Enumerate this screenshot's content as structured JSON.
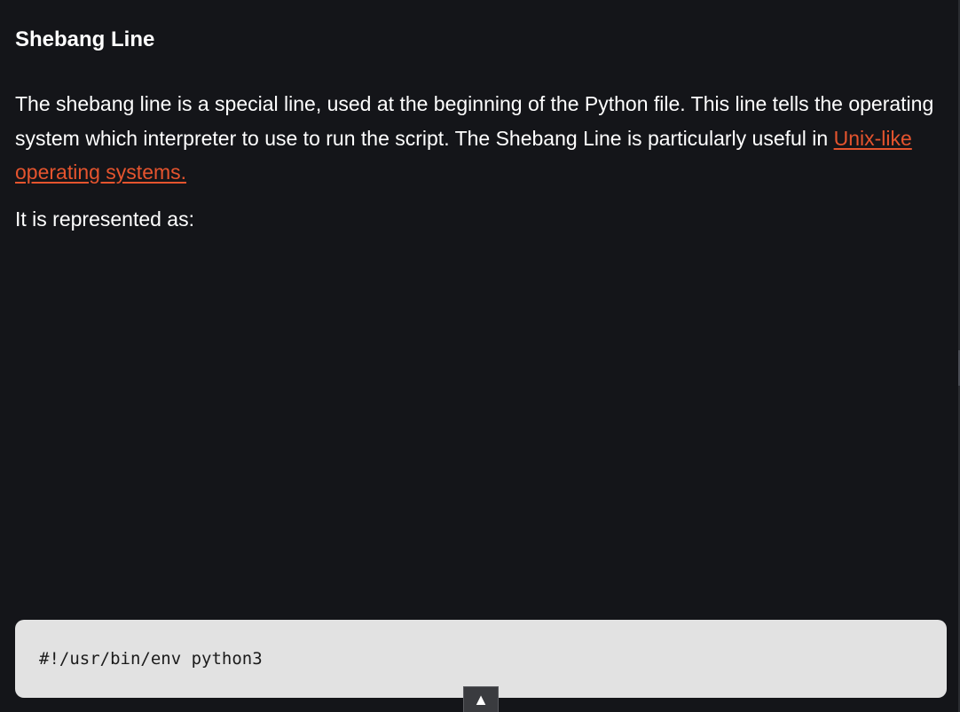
{
  "article": {
    "heading": "Shebang Line",
    "paragraph_1_text": "The shebang line is a special line, used at the beginning of the Python file. This line tells the operating system which interpreter to use to run the script. The Shebang Line is particularly useful in ",
    "paragraph_1_link": "Unix-like operating systems.",
    "paragraph_2": "It is represented as:"
  },
  "code": {
    "content": "#!/usr/bin/env python3"
  },
  "scroll_top": {
    "icon": "▲",
    "icon_name": "arrow-up-icon"
  },
  "colors": {
    "background": "#141519",
    "link": "#e5542e",
    "code_background": "#e2e2e2"
  }
}
